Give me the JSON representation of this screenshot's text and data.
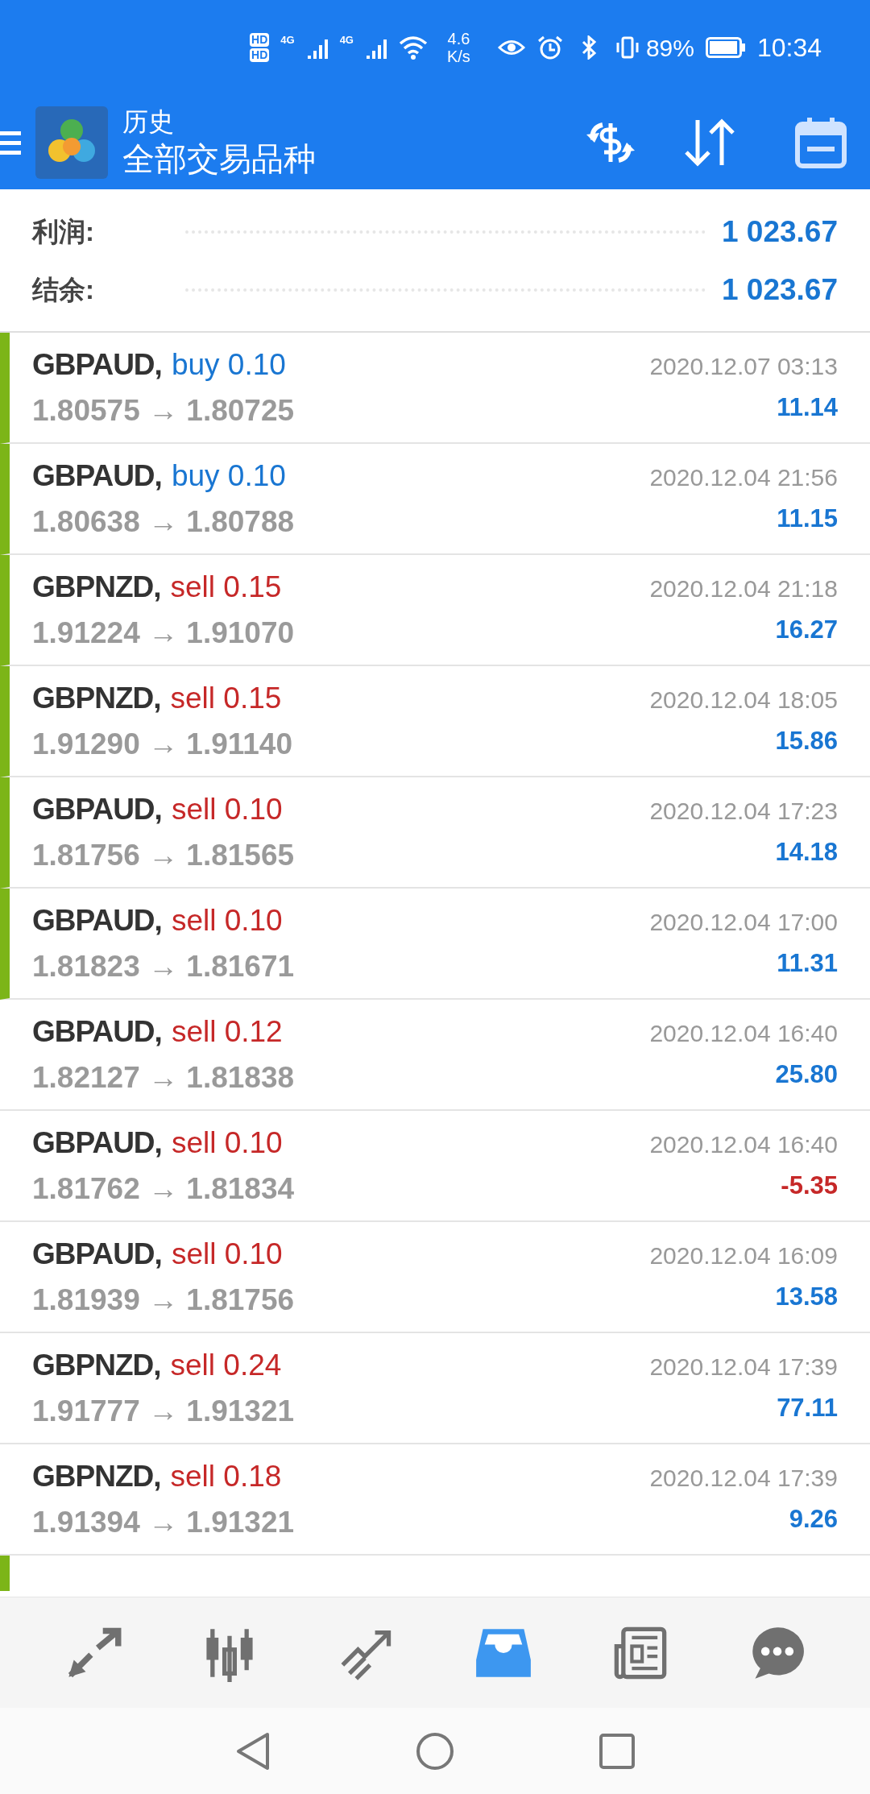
{
  "status_bar": {
    "sim_labels": [
      "HD",
      "HD"
    ],
    "network_labels": [
      "4G",
      "4G"
    ],
    "speed_value": "4.6",
    "speed_unit": "K/s",
    "battery": "89%",
    "time": "10:34"
  },
  "header": {
    "title": "历史",
    "subtitle": "全部交易品种"
  },
  "summary": [
    {
      "label": "利润:",
      "value": "1 023.67"
    },
    {
      "label": "结余:",
      "value": "1 023.67"
    }
  ],
  "trades": [
    {
      "symbol": "GBPAUD,",
      "kind": "buy",
      "side": "buy 0.10",
      "prices": "1.80575 → 1.80725",
      "time": "2020.12.07 03:13",
      "profit": "11.14",
      "loss": false,
      "marked": true
    },
    {
      "symbol": "GBPAUD,",
      "kind": "buy",
      "side": "buy 0.10",
      "prices": "1.80638 → 1.80788",
      "time": "2020.12.04 21:56",
      "profit": "11.15",
      "loss": false,
      "marked": true
    },
    {
      "symbol": "GBPNZD,",
      "kind": "sell",
      "side": "sell 0.15",
      "prices": "1.91224 → 1.91070",
      "time": "2020.12.04 21:18",
      "profit": "16.27",
      "loss": false,
      "marked": true
    },
    {
      "symbol": "GBPNZD,",
      "kind": "sell",
      "side": "sell 0.15",
      "prices": "1.91290 → 1.91140",
      "time": "2020.12.04 18:05",
      "profit": "15.86",
      "loss": false,
      "marked": true
    },
    {
      "symbol": "GBPAUD,",
      "kind": "sell",
      "side": "sell 0.10",
      "prices": "1.81756 → 1.81565",
      "time": "2020.12.04 17:23",
      "profit": "14.18",
      "loss": false,
      "marked": true
    },
    {
      "symbol": "GBPAUD,",
      "kind": "sell",
      "side": "sell 0.10",
      "prices": "1.81823 → 1.81671",
      "time": "2020.12.04 17:00",
      "profit": "11.31",
      "loss": false,
      "marked": true
    },
    {
      "symbol": "GBPAUD,",
      "kind": "sell",
      "side": "sell 0.12",
      "prices": "1.82127 → 1.81838",
      "time": "2020.12.04 16:40",
      "profit": "25.80",
      "loss": false,
      "marked": false
    },
    {
      "symbol": "GBPAUD,",
      "kind": "sell",
      "side": "sell 0.10",
      "prices": "1.81762 → 1.81834",
      "time": "2020.12.04 16:40",
      "profit": "-5.35",
      "loss": true,
      "marked": false
    },
    {
      "symbol": "GBPAUD,",
      "kind": "sell",
      "side": "sell 0.10",
      "prices": "1.81939 → 1.81756",
      "time": "2020.12.04 16:09",
      "profit": "13.58",
      "loss": false,
      "marked": false
    },
    {
      "symbol": "GBPNZD,",
      "kind": "sell",
      "side": "sell 0.24",
      "prices": "1.91777 → 1.91321",
      "time": "2020.12.04 17:39",
      "profit": "77.11",
      "loss": false,
      "marked": false
    },
    {
      "symbol": "GBPNZD,",
      "kind": "sell",
      "side": "sell 0.18",
      "prices": "1.91394 → 1.91321",
      "time": "2020.12.04 17:39",
      "profit": "9.26",
      "loss": false,
      "marked": false
    }
  ],
  "cut_off_row": {
    "marked": true
  },
  "bottom_nav": [
    {
      "kind": "trade",
      "selected": false
    },
    {
      "kind": "chart",
      "selected": false
    },
    {
      "kind": "trend",
      "selected": false
    },
    {
      "kind": "history",
      "selected": true
    },
    {
      "kind": "news",
      "selected": false
    },
    {
      "kind": "chat",
      "selected": false
    }
  ]
}
